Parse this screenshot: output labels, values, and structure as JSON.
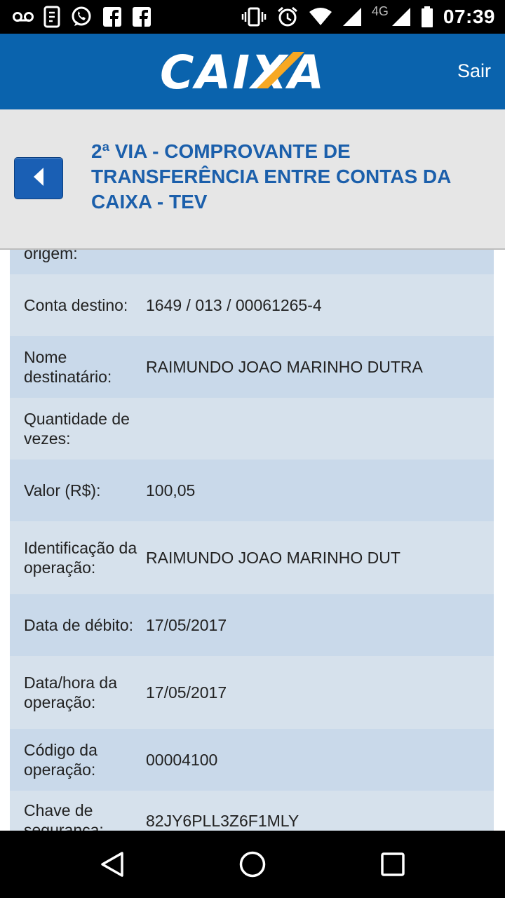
{
  "status_bar": {
    "time": "07:39",
    "network": "4G",
    "icons_left": [
      "voicemail-icon",
      "screenshot-icon",
      "whatsapp-icon",
      "facebook-icon",
      "facebook-icon"
    ],
    "icons_right": [
      "vibrate-icon",
      "alarm-icon",
      "wifi-icon",
      "signal-icon",
      "signal-icon",
      "battery-icon"
    ]
  },
  "header": {
    "logo_text": "CAIXA",
    "exit_label": "Sair",
    "color": "#0a63ad",
    "accent": "#f7a823"
  },
  "page": {
    "title": "2ª VIA - COMPROVANTE DE TRANSFERÊNCIA ENTRE CONTAS DA CAIXA - TEV"
  },
  "rows": [
    {
      "label": "origem:",
      "value": ""
    },
    {
      "label": "Conta destino:",
      "value": "1649 / 013 / 00061265-4"
    },
    {
      "label": "Nome destinatário:",
      "value": "RAIMUNDO JOAO MARINHO DUTRA"
    },
    {
      "label": "Quantidade de vezes:",
      "value": ""
    },
    {
      "label": "Valor (R$):",
      "value": "100,05"
    },
    {
      "label": "Identificação da operação:",
      "value": "RAIMUNDO JOAO MARINHO DUT"
    },
    {
      "label": "Data de débito:",
      "value": "17/05/2017"
    },
    {
      "label": "Data/hora da operação:",
      "value": "17/05/2017"
    },
    {
      "label": "Código da operação:",
      "value": "00004100"
    },
    {
      "label": "Chave de segurança:",
      "value": "82JY6PLL3Z6F1MLY"
    }
  ]
}
